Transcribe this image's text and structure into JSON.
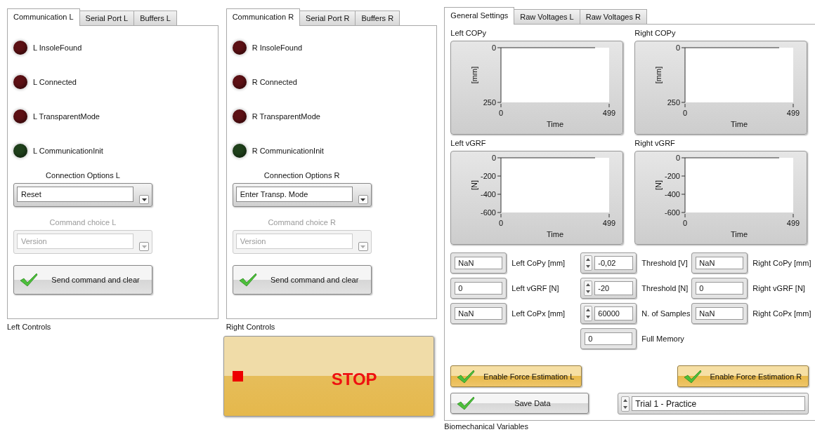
{
  "left": {
    "tabs": [
      {
        "label": "Communication L",
        "selected": true
      },
      {
        "label": "Serial Port L",
        "selected": false
      },
      {
        "label": "Buffers L",
        "selected": false
      }
    ],
    "leds": [
      {
        "label": "L InsoleFound",
        "color": "#5c1014"
      },
      {
        "label": "L Connected",
        "color": "#5c1014"
      },
      {
        "label": "L TransparentMode",
        "color": "#5c1014"
      },
      {
        "label": "L CommunicationInit",
        "color": "#1f401b"
      }
    ],
    "connection_options": {
      "label": "Connection Options L",
      "value": "Reset",
      "disabled": false
    },
    "command_choice": {
      "label": "Command choice L",
      "value": "Version",
      "disabled": true
    },
    "send_button": "Send command and clear",
    "caption": "Left Controls"
  },
  "right": {
    "tabs": [
      {
        "label": "Communication R",
        "selected": true
      },
      {
        "label": "Serial Port R",
        "selected": false
      },
      {
        "label": "Buffers R",
        "selected": false
      }
    ],
    "leds": [
      {
        "label": "R InsoleFound",
        "color": "#5c1014"
      },
      {
        "label": "R Connected",
        "color": "#5c1014"
      },
      {
        "label": "R TransparentMode",
        "color": "#5c1014"
      },
      {
        "label": "R CommunicationInit",
        "color": "#1f401b"
      }
    ],
    "connection_options": {
      "label": "Connection Options R",
      "value": "Enter Transp. Mode",
      "disabled": false
    },
    "command_choice": {
      "label": "Command choice R",
      "value": "Version",
      "disabled": true
    },
    "send_button": "Send command and clear",
    "caption": "Right Controls"
  },
  "stop_button": "STOP",
  "biomech": {
    "tabs": [
      {
        "label": "General Settings",
        "selected": true
      },
      {
        "label": "Raw Voltages L",
        "selected": false
      },
      {
        "label": "Raw Voltages R",
        "selected": false
      }
    ],
    "graphs": [
      {
        "title": "Left COPy",
        "xlabel": "Time",
        "ylabel": "[mm]",
        "x_tick_labels": [
          "0",
          "499"
        ],
        "y_tick_labels": [
          "0",
          "250"
        ]
      },
      {
        "title": "Right COPy",
        "xlabel": "Time",
        "ylabel": "[mm]",
        "x_tick_labels": [
          "0",
          "499"
        ],
        "y_tick_labels": [
          "0",
          "250"
        ]
      },
      {
        "title": "Left vGRF",
        "xlabel": "Time",
        "ylabel": "[N]",
        "x_tick_labels": [
          "0",
          "499"
        ],
        "y_tick_labels": [
          "0",
          "-200",
          "-400",
          "-600"
        ]
      },
      {
        "title": "Right vGRF",
        "xlabel": "Time",
        "ylabel": "[N]",
        "x_tick_labels": [
          "0",
          "499"
        ],
        "y_tick_labels": [
          "0",
          "-200",
          "-400",
          "-600"
        ]
      }
    ],
    "readouts": {
      "left": [
        {
          "value": "NaN",
          "label": "Left CoPy [mm]",
          "kind": "indicator"
        },
        {
          "value": "0",
          "label": "Left vGRF [N]",
          "kind": "indicator"
        },
        {
          "value": "NaN",
          "label": "Left CoPx [mm]",
          "kind": "indicator"
        }
      ],
      "middle": [
        {
          "value": "-0,02",
          "label": "Threshold [V]",
          "kind": "control"
        },
        {
          "value": "-20",
          "label": "Threshold [N]",
          "kind": "control"
        },
        {
          "value": "60000",
          "label": "N. of Samples",
          "kind": "control"
        },
        {
          "value": "0",
          "label": "Full Memory",
          "kind": "indicator"
        }
      ],
      "right": [
        {
          "value": "NaN",
          "label": "Right CoPy [mm]",
          "kind": "indicator"
        },
        {
          "value": "0",
          "label": "Right vGRF [N]",
          "kind": "indicator"
        },
        {
          "value": "NaN",
          "label": "Right CoPx [mm]",
          "kind": "indicator"
        }
      ]
    },
    "buttons": [
      {
        "label": "Enable Force Estimation L",
        "kind": "gold"
      },
      {
        "label": "Enable Force Estimation R",
        "kind": "gold"
      },
      {
        "label": "Save Data",
        "kind": "plain"
      }
    ],
    "trial": {
      "value": "Trial 1 - Practice"
    },
    "caption": "Biomechanical Variables"
  }
}
